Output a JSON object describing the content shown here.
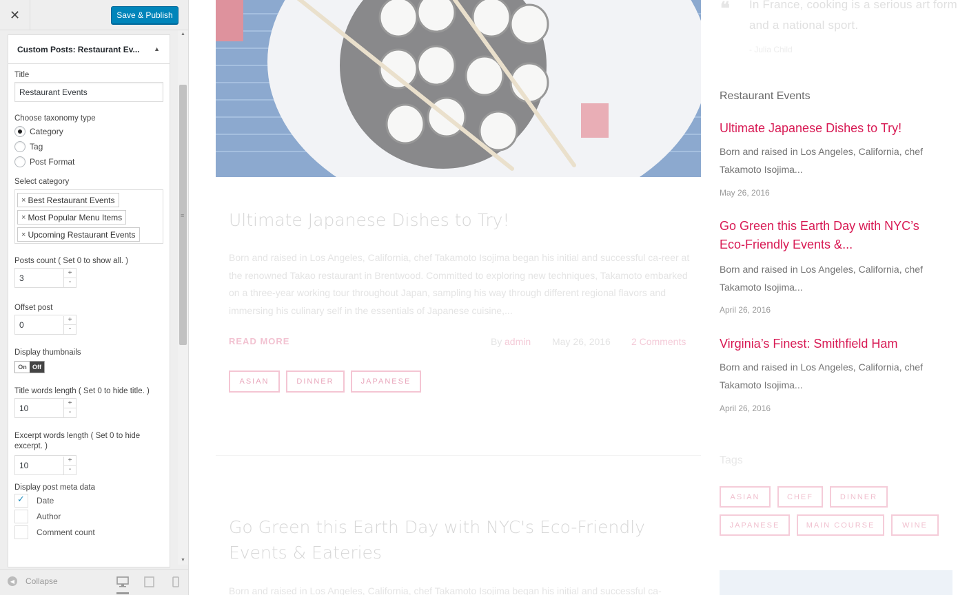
{
  "customizer": {
    "close_glyph": "✕",
    "publish_label": "Save & Publish",
    "panel_title_prefix": "Custom Posts:",
    "panel_title_suffix": "Restaurant Ev...",
    "title_label": "Title",
    "title_value": "Restaurant Events",
    "taxonomy_label": "Choose taxonomy type",
    "taxonomy_options": [
      "Category",
      "Tag",
      "Post Format"
    ],
    "taxonomy_selected": "Category",
    "category_label": "Select category",
    "categories": [
      "Best Restaurant Events",
      "Most Popular Menu Items",
      "Upcoming Restaurant Events"
    ],
    "tag_remove_glyph": "×",
    "posts_count_label": "Posts count ( Set 0 to show all. )",
    "posts_count_value": "3",
    "offset_label": "Offset post",
    "offset_value": "0",
    "thumbs_label": "Display thumbnails",
    "toggle_on": "On",
    "toggle_off": "Off",
    "title_len_label": "Title words length ( Set 0 to hide title. )",
    "title_len_value": "10",
    "excerpt_len_label": "Excerpt words length ( Set 0 to hide excerpt. )",
    "excerpt_len_value": "10",
    "meta_label": "Display post meta data",
    "meta_options": [
      {
        "label": "Date",
        "checked": true
      },
      {
        "label": "Author",
        "checked": false
      },
      {
        "label": "Comment count",
        "checked": false
      }
    ],
    "spin_up": "+",
    "spin_down": "-",
    "collapse_label": "Collapse",
    "collapse_glyph": "◀"
  },
  "preview": {
    "post1": {
      "title": "Ultimate Japanese Dishes to Try!",
      "body": "Born and raised in Los Angeles, California, chef Takamoto Isojima began his initial and successful ca-reer at the renowned Takao restaurant in Brentwood. Committed to exploring new techniques, Takamoto embarked on a three-year working tour throughout Japan, sampling his way through different regional flavors and immersing his culinary self in the essentials of Japanese cuisine,...",
      "read_more": "READ MORE",
      "by": "By",
      "author": "admin",
      "date": "May 26, 2016",
      "comments": "2 Comments",
      "tags": [
        "ASIAN",
        "DINNER",
        "JAPANESE"
      ]
    },
    "post2": {
      "title": "Go Green this Earth Day with NYC's Eco-Friendly Events & Eateries",
      "body": "Born and raised in Los Angeles, California, chef Takamoto Isojima began his initial and successful ca-"
    },
    "quote": {
      "mark": "❝",
      "text": "In France, cooking is a serious art form and a national sport.",
      "author": "- Julia Child"
    },
    "widget": {
      "heading": "Restaurant Events",
      "items": [
        {
          "title": "Ultimate Japanese Dishes to Try!",
          "excerpt": "Born and raised in Los Angeles, California, chef Takamoto Isojima...",
          "date": "May 26, 2016"
        },
        {
          "title": "Go Green this Earth Day with NYC’s Eco-Friendly Events &...",
          "excerpt": "Born and raised in Los Angeles, California, chef Takamoto Isojima...",
          "date": "April 26, 2016"
        },
        {
          "title": "Virginia’s Finest: Smithfield Ham",
          "excerpt": "Born and raised in Los Angeles, California, chef Takamoto Isojima...",
          "date": "April 26, 2016"
        }
      ]
    },
    "tags_heading": "Tags",
    "tag_cloud": [
      "ASIAN",
      "CHEF",
      "DINNER",
      "JAPANESE",
      "MAIN COURSE",
      "WINE"
    ]
  }
}
